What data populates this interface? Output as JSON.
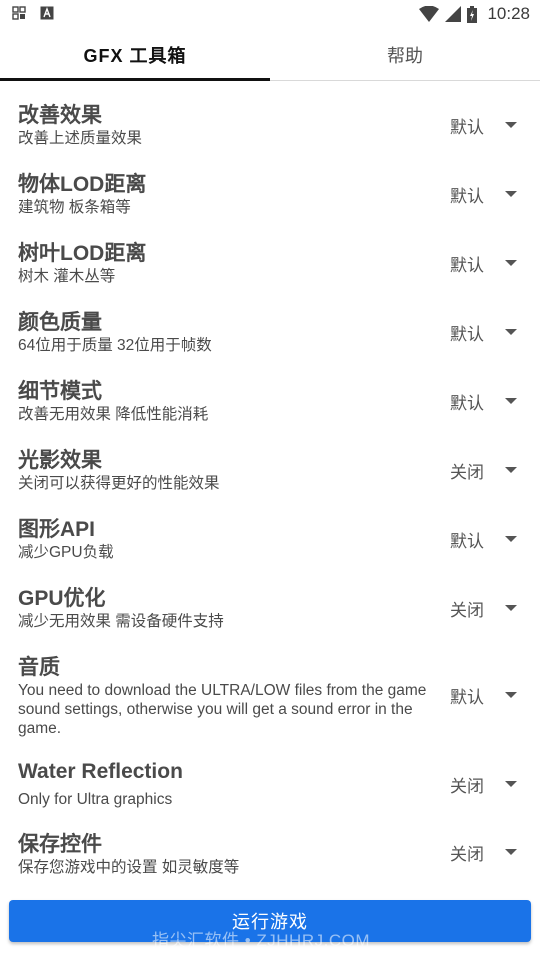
{
  "status_bar": {
    "time": "10:28",
    "icons": [
      "notification-grid-icon",
      "notification-a-icon",
      "wifi-icon",
      "cell-signal-icon",
      "battery-icon"
    ]
  },
  "tabs": [
    {
      "label": "GFX 工具箱",
      "active": true
    },
    {
      "label": "帮助",
      "active": false
    }
  ],
  "settings": [
    {
      "title": "改善效果",
      "desc": "改善上述质量效果",
      "value": "默认"
    },
    {
      "title": "物体LOD距离",
      "desc": "建筑物 板条箱等",
      "value": "默认"
    },
    {
      "title": "树叶LOD距离",
      "desc": "树木 灌木丛等",
      "value": "默认"
    },
    {
      "title": "颜色质量",
      "desc": "64位用于质量 32位用于帧数",
      "value": "默认"
    },
    {
      "title": "细节模式",
      "desc": "改善无用效果 降低性能消耗",
      "value": "默认"
    },
    {
      "title": "光影效果",
      "desc": "关闭可以获得更好的性能效果",
      "value": "关闭"
    },
    {
      "title": "图形API",
      "desc": "减少GPU负载",
      "value": "默认"
    },
    {
      "title": "GPU优化",
      "desc": "减少无用效果 需设备硬件支持",
      "value": "关闭"
    },
    {
      "title": "音质",
      "desc": "You need to download the ULTRA/LOW files from the game sound settings, otherwise you will get a sound error in the game.",
      "value": "默认"
    },
    {
      "title": "Water Reflection",
      "desc": "Only for Ultra graphics",
      "value": "关闭"
    },
    {
      "title": "保存控件",
      "desc": "保存您游戏中的设置 如灵敏度等",
      "value": "关闭"
    }
  ],
  "run_button": {
    "label": "运行游戏"
  },
  "watermark": "指尖汇软件 • ZJHHRJ.COM",
  "colors": {
    "accent": "#1a73e8",
    "tab_indicator": "#111111"
  }
}
